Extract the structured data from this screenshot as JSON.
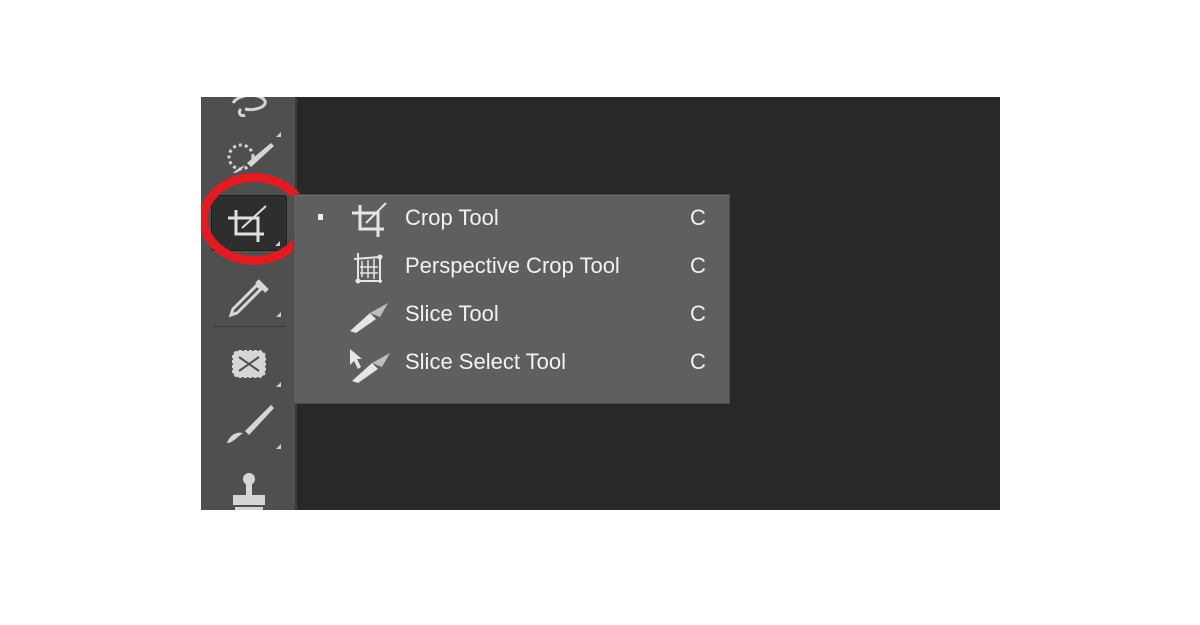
{
  "flyout_menu": {
    "items": [
      {
        "label": "Crop Tool",
        "shortcut": "C",
        "icon": "crop-icon",
        "selected": true
      },
      {
        "label": "Perspective Crop Tool",
        "shortcut": "C",
        "icon": "perspective-crop-icon",
        "selected": false
      },
      {
        "label": "Slice Tool",
        "shortcut": "C",
        "icon": "slice-icon",
        "selected": false
      },
      {
        "label": "Slice Select Tool",
        "shortcut": "C",
        "icon": "slice-select-icon",
        "selected": false
      }
    ]
  },
  "toolbar": {
    "tools": [
      {
        "name": "lasso-icon"
      },
      {
        "name": "quick-selection-icon"
      },
      {
        "name": "crop-icon",
        "active": true
      },
      {
        "name": "eyedropper-icon"
      },
      {
        "name": "spot-healing-icon"
      },
      {
        "name": "brush-icon"
      },
      {
        "name": "clone-stamp-icon"
      }
    ]
  },
  "colors": {
    "canvas": "#282828",
    "toolbar": "#4f4f4f",
    "menu": "#5f5f5f",
    "text": "#f2f2f2",
    "highlight": "#e11b22"
  }
}
